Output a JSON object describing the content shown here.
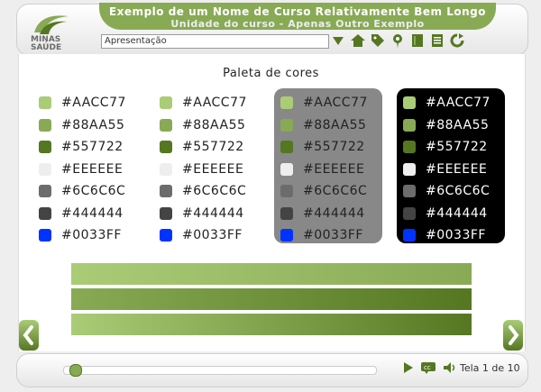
{
  "app": {
    "course_title": "Exemplo de um Nome  de Curso Relativamente Bem Longo",
    "course_subtitle": "Unidade do curso  - Apenas Outro Exemplo",
    "logo_text_line1": "MINAS",
    "logo_text_line2": "SAÚDE"
  },
  "toolbar": {
    "page_select_value": "Apresentação",
    "icons": [
      "chevron-down-icon",
      "home-icon",
      "tag-icon",
      "pin-icon",
      "book-icon",
      "notes-icon",
      "refresh-icon"
    ]
  },
  "main": {
    "title": "Paleta de cores",
    "palettes": [
      {
        "background": "#FFFFFF",
        "text_color": "#222222",
        "items": [
          {
            "hex": "#AACC77",
            "label": "#AACC77"
          },
          {
            "hex": "#88AA55",
            "label": "#88AA55"
          },
          {
            "hex": "#557722",
            "label": "#557722"
          },
          {
            "hex": "#EEEEEE",
            "label": "#EEEEEE"
          },
          {
            "hex": "#6C6C6C",
            "label": "#6C6C6C"
          },
          {
            "hex": "#444444",
            "label": "#444444"
          },
          {
            "hex": "#0033FF",
            "label": "#0033FF"
          }
        ]
      },
      {
        "background": "#FFFFFF",
        "text_color": "#222222",
        "items": [
          {
            "hex": "#AACC77",
            "label": "#AACC77"
          },
          {
            "hex": "#88AA55",
            "label": "#88AA55"
          },
          {
            "hex": "#557722",
            "label": "#557722"
          },
          {
            "hex": "#EEEEEE",
            "label": "#EEEEEE"
          },
          {
            "hex": "#6C6C6C",
            "label": "#6C6C6C"
          },
          {
            "hex": "#444444",
            "label": "#444444"
          },
          {
            "hex": "#0033FF",
            "label": "#0033FF"
          }
        ]
      },
      {
        "background": "#888888",
        "text_color": "#222222",
        "items": [
          {
            "hex": "#AACC77",
            "label": "#AACC77"
          },
          {
            "hex": "#88AA55",
            "label": "#88AA55"
          },
          {
            "hex": "#557722",
            "label": "#557722"
          },
          {
            "hex": "#EEEEEE",
            "label": "#EEEEEE"
          },
          {
            "hex": "#6C6C6C",
            "label": "#6C6C6C"
          },
          {
            "hex": "#444444",
            "label": "#444444"
          },
          {
            "hex": "#0033FF",
            "label": "#0033FF"
          }
        ]
      },
      {
        "background": "#000000",
        "text_color": "#FFFFFF",
        "items": [
          {
            "hex": "#AACC77",
            "label": "#AACC77"
          },
          {
            "hex": "#88AA55",
            "label": "#88AA55"
          },
          {
            "hex": "#557722",
            "label": "#557722"
          },
          {
            "hex": "#EEEEEE",
            "label": "#EEEEEE"
          },
          {
            "hex": "#6C6C6C",
            "label": "#6C6C6C"
          },
          {
            "hex": "#444444",
            "label": "#444444"
          },
          {
            "hex": "#0033FF",
            "label": "#0033FF"
          }
        ]
      }
    ],
    "gradient_bars": [
      {
        "from": "#AACC77",
        "to": "#88AA55"
      },
      {
        "from": "#88AA55",
        "to": "#557722"
      },
      {
        "from": "#AACC77",
        "to": "#557722"
      }
    ]
  },
  "footer": {
    "page_indicator": "Tela 1 de 10",
    "progress": 0.02,
    "controls": [
      "play-icon",
      "captions-icon",
      "volume-icon"
    ]
  },
  "nav": {
    "prev_icon": "chevron-left-icon",
    "next_icon": "chevron-right-icon"
  }
}
